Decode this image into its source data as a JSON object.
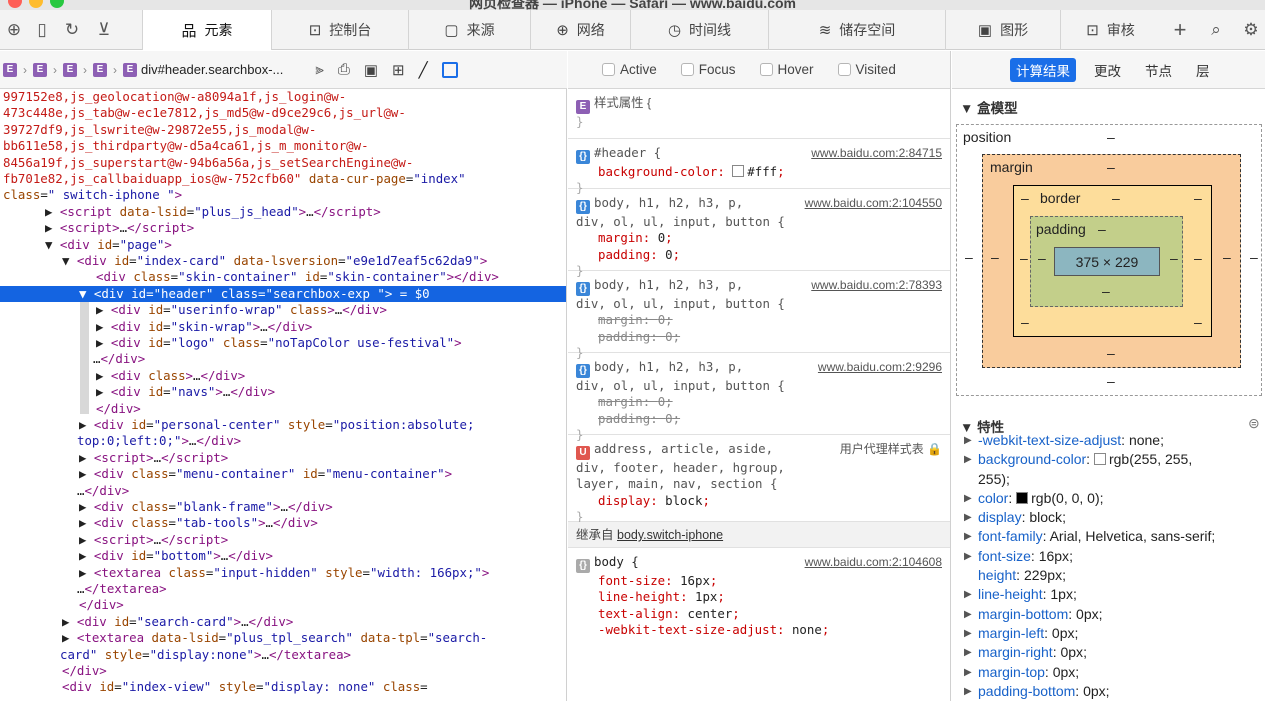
{
  "window": {
    "title": "网页检查器 — iPhone — Safari — www.baidu.com"
  },
  "tabs": [
    {
      "label": "元素",
      "selected": true
    },
    {
      "label": "控制台"
    },
    {
      "label": "来源"
    },
    {
      "label": "网络"
    },
    {
      "label": "时间线"
    },
    {
      "label": "储存空间"
    },
    {
      "label": "图形"
    },
    {
      "label": "审核"
    }
  ],
  "breadcrumb": {
    "badge": "E",
    "last": "div#header.searchbox-..."
  },
  "dom_lines": [
    {
      "i": 3,
      "html": "<span class='red'>997152e8,js_geolocation@w-a8094a1f,js_login@w-</span>"
    },
    {
      "i": 3,
      "html": "<span class='red'>473c448e,js_tab@w-ec1e7812,js_md5@w-d9ce29c6,js_url@w-</span>"
    },
    {
      "i": 3,
      "html": "<span class='red'>39727df9,js_lswrite@w-29872e55,js_modal@w-</span>"
    },
    {
      "i": 3,
      "html": "<span class='red'>bb611e58,js_thirdparty@w-d5a4ca61,js_m_monitor@w-</span>"
    },
    {
      "i": 3,
      "html": "<span class='red'>8456a19f,js_superstart@w-94b6a56a,js_setSearchEngine@w-</span>"
    },
    {
      "i": 3,
      "html": "<span class='red'>fb701e82,js_callbaiduapp_ios@w-752cfb60\"</span> <span class='an'>data-cur-page</span>=<span class='av'>\"index\"</span>"
    },
    {
      "i": 3,
      "html": "<span class='an'>class</span>=<span class='av'>\" switch-iphone \"</span><span class='tg'>&gt;</span>"
    },
    {
      "i": 45,
      "html": "<span class='tx'>▶ </span><span class='tg'>&lt;script</span> <span class='an'>data-lsid</span>=<span class='av'>\"plus_js_head\"</span><span class='tg'>&gt;</span>…<span class='tg'>&lt;/script&gt;</span>"
    },
    {
      "i": 45,
      "html": "<span class='tx'>▶ </span><span class='tg'>&lt;script&gt;</span>…<span class='tg'>&lt;/script&gt;</span>"
    },
    {
      "i": 45,
      "html": "<span class='tx'>▼ </span><span class='tg'>&lt;div</span> <span class='an'>id</span>=<span class='av'>\"page\"</span><span class='tg'>&gt;</span>"
    },
    {
      "i": 62,
      "html": "<span class='tx'>▼ </span><span class='tg'>&lt;div</span> <span class='an'>id</span>=<span class='av'>\"index-card\"</span> <span class='an'>data-lsversion</span>=<span class='av'>\"e9e1d7eaf5c62da9\"</span><span class='tg'>&gt;</span>"
    },
    {
      "i": 96,
      "html": "<span class='tg'>&lt;div</span> <span class='an'>class</span>=<span class='av'>\"skin-container\"</span> <span class='an'>id</span>=<span class='av'>\"skin-container\"</span><span class='tg'>&gt;&lt;/div&gt;</span>"
    },
    {
      "i": 79,
      "sel": true,
      "html": "▼ &lt;div id=\"header\" class=\"searchbox-exp \"&gt; = $0"
    },
    {
      "i": 96,
      "html": "<span class='tx'>▶ </span><span class='tg'>&lt;div</span> <span class='an'>id</span>=<span class='av'>\"userinfo-wrap\"</span> <span class='an'>class</span><span class='tg'>&gt;</span>…<span class='tg'>&lt;/div&gt;</span>"
    },
    {
      "i": 96,
      "html": "<span class='tx'>▶ </span><span class='tg'>&lt;div</span> <span class='an'>id</span>=<span class='av'>\"skin-wrap\"</span><span class='tg'>&gt;</span>…<span class='tg'>&lt;/div&gt;</span>"
    },
    {
      "i": 96,
      "html": "<span class='tx'>▶ </span><span class='tg'>&lt;div</span> <span class='an'>id</span>=<span class='av'>\"logo\"</span> <span class='an'>class</span>=<span class='av'>\"noTapColor use-festival\"</span><span class='tg'>&gt;</span>"
    },
    {
      "i": 93,
      "html": "…<span class='tg'>&lt;/div&gt;</span>"
    },
    {
      "i": 96,
      "html": "<span class='tx'>▶ </span><span class='tg'>&lt;div</span> <span class='an'>class</span><span class='tg'>&gt;</span>…<span class='tg'>&lt;/div&gt;</span>"
    },
    {
      "i": 96,
      "html": "<span class='tx'>▶ </span><span class='tg'>&lt;div</span> <span class='an'>id</span>=<span class='av'>\"navs\"</span><span class='tg'>&gt;</span>…<span class='tg'>&lt;/div&gt;</span>"
    },
    {
      "i": 96,
      "html": "<span class='tg'>&lt;/div&gt;</span>"
    },
    {
      "i": 79,
      "html": "<span class='tx'>▶ </span><span class='tg'>&lt;div</span> <span class='an'>id</span>=<span class='av'>\"personal-center\"</span> <span class='an'>style</span>=<span class='av'>\"position:absolute;</span>"
    },
    {
      "i": 77,
      "html": "<span class='av'>top:0;left:0;\"</span><span class='tg'>&gt;</span>…<span class='tg'>&lt;/div&gt;</span>"
    },
    {
      "i": 79,
      "html": "<span class='tx'>▶ </span><span class='tg'>&lt;script&gt;</span>…<span class='tg'>&lt;/script&gt;</span>"
    },
    {
      "i": 79,
      "html": "<span class='tx'>▶ </span><span class='tg'>&lt;div</span> <span class='an'>class</span>=<span class='av'>\"menu-container\"</span> <span class='an'>id</span>=<span class='av'>\"menu-container\"</span><span class='tg'>&gt;</span>"
    },
    {
      "i": 77,
      "html": "…<span class='tg'>&lt;/div&gt;</span>"
    },
    {
      "i": 79,
      "html": "<span class='tx'>▶ </span><span class='tg'>&lt;div</span> <span class='an'>class</span>=<span class='av'>\"blank-frame\"</span><span class='tg'>&gt;</span>…<span class='tg'>&lt;/div&gt;</span>"
    },
    {
      "i": 79,
      "html": "<span class='tx'>▶ </span><span class='tg'>&lt;div</span> <span class='an'>class</span>=<span class='av'>\"tab-tools\"</span><span class='tg'>&gt;</span>…<span class='tg'>&lt;/div&gt;</span>"
    },
    {
      "i": 79,
      "html": "<span class='tx'>▶ </span><span class='tg'>&lt;script&gt;</span>…<span class='tg'>&lt;/script&gt;</span>"
    },
    {
      "i": 79,
      "html": "<span class='tx'>▶ </span><span class='tg'>&lt;div</span> <span class='an'>id</span>=<span class='av'>\"bottom\"</span><span class='tg'>&gt;</span>…<span class='tg'>&lt;/div&gt;</span>"
    },
    {
      "i": 79,
      "html": "<span class='tx'>▶ </span><span class='tg'>&lt;textarea</span> <span class='an'>class</span>=<span class='av'>\"input-hidden\"</span> <span class='an'>style</span>=<span class='av'>\"width: 166px;\"</span><span class='tg'>&gt;</span>"
    },
    {
      "i": 77,
      "html": "…<span class='tg'>&lt;/textarea&gt;</span>"
    },
    {
      "i": 79,
      "html": "<span class='tg'>&lt;/div&gt;</span>"
    },
    {
      "i": 62,
      "html": "<span class='tx'>▶ </span><span class='tg'>&lt;div</span> <span class='an'>id</span>=<span class='av'>\"search-card\"</span><span class='tg'>&gt;</span>…<span class='tg'>&lt;/div&gt;</span>"
    },
    {
      "i": 62,
      "html": "<span class='tx'>▶ </span><span class='tg'>&lt;textarea</span> <span class='an'>data-lsid</span>=<span class='av'>\"plus_tpl_search\"</span> <span class='an'>data-tpl</span>=<span class='av'>\"search-</span>"
    },
    {
      "i": 60,
      "html": "<span class='av'>card\"</span> <span class='an'>style</span>=<span class='av'>\"display:none\"</span><span class='tg'>&gt;</span>…<span class='tg'>&lt;/textarea&gt;</span>"
    },
    {
      "i": 62,
      "html": "<span class='tg'>&lt;/div&gt;</span>"
    },
    {
      "i": 62,
      "html": "<span class='tg'>&lt;div</span> <span class='an'>id</span>=<span class='av'>\"index-view\"</span> <span class='an'>style</span>=<span class='av'>\"display: none\"</span> <span class='an'>class</span>="
    }
  ],
  "filters": [
    "Active",
    "Focus",
    "Hover",
    "Visited"
  ],
  "styles": {
    "style_attr": "样式属性 {",
    "rules": [
      {
        "selector": "#header {",
        "source": "www.baidu.com:2:84715",
        "props": [
          {
            "n": "background-color",
            "v": "#fff",
            "swatch": true
          }
        ]
      },
      {
        "selector": "body, h1, h2, h3, p,",
        "selector2": "div, ol, ul, input, button {",
        "source": "www.baidu.com:2:104550",
        "props": [
          {
            "n": "margin",
            "v": "0"
          },
          {
            "n": "padding",
            "v": "0"
          }
        ]
      },
      {
        "selector": "body, h1, h2, h3, p,",
        "selector2": "div, ol, ul, input, button {",
        "source": "www.baidu.com:2:78393",
        "props": [
          {
            "n": "margin",
            "v": "0",
            "strike": true
          },
          {
            "n": "padding",
            "v": "0",
            "strike": true
          }
        ]
      },
      {
        "selector": "body, h1, h2, h3, p,",
        "selector2": "div, ol, ul, input, button {",
        "source": "www.baidu.com:2:9296",
        "props": [
          {
            "n": "margin",
            "v": "0",
            "strike": true
          },
          {
            "n": "padding",
            "v": "0",
            "strike": true
          }
        ]
      },
      {
        "selector": "address, article, aside,",
        "selector2": "div, footer, header, hgroup,",
        "selector3": "layer, main, nav, section {",
        "source": "用户代理样式表 🔒",
        "props": [
          {
            "n": "display",
            "v": "block"
          }
        ]
      }
    ],
    "inherited_label": "继承自",
    "inherited_from": "body.switch-iphone",
    "body_rule": {
      "selector": "body {",
      "source": "www.baidu.com:2:104608",
      "props": [
        {
          "n": "font-size",
          "v": "16px"
        },
        {
          "n": "line-height",
          "v": "1px"
        },
        {
          "n": "text-align",
          "v": "center"
        },
        {
          "n": "-webkit-text-size-adjust",
          "v": "none"
        }
      ]
    }
  },
  "right_tabs": [
    {
      "label": "计算结果",
      "selected": true
    },
    {
      "label": "更改"
    },
    {
      "label": "节点"
    },
    {
      "label": "层"
    }
  ],
  "boxmodel": {
    "heading": "盒模型",
    "position": "position",
    "margin": "margin",
    "border": "border",
    "padding": "padding",
    "content": "375 × 229",
    "dash": "–"
  },
  "computed": {
    "heading": "特性",
    "props": [
      {
        "n": "-webkit-text-size-adjust",
        "v": "none"
      },
      {
        "n": "background-color",
        "v": "rgb(255, 255,",
        "v2": "255)",
        "swatch": "#ffffff"
      },
      {
        "n": "color",
        "v": "rgb(0, 0, 0)",
        "swatch": "#000000"
      },
      {
        "n": "display",
        "v": "block"
      },
      {
        "n": "font-family",
        "v": "Arial, Helvetica, sans-serif"
      },
      {
        "n": "font-size",
        "v": "16px"
      },
      {
        "n": "height",
        "v": "229px",
        "notri": true
      },
      {
        "n": "line-height",
        "v": "1px"
      },
      {
        "n": "margin-bottom",
        "v": "0px"
      },
      {
        "n": "margin-left",
        "v": "0px"
      },
      {
        "n": "margin-right",
        "v": "0px"
      },
      {
        "n": "margin-top",
        "v": "0px"
      },
      {
        "n": "padding-bottom",
        "v": "0px"
      }
    ]
  }
}
